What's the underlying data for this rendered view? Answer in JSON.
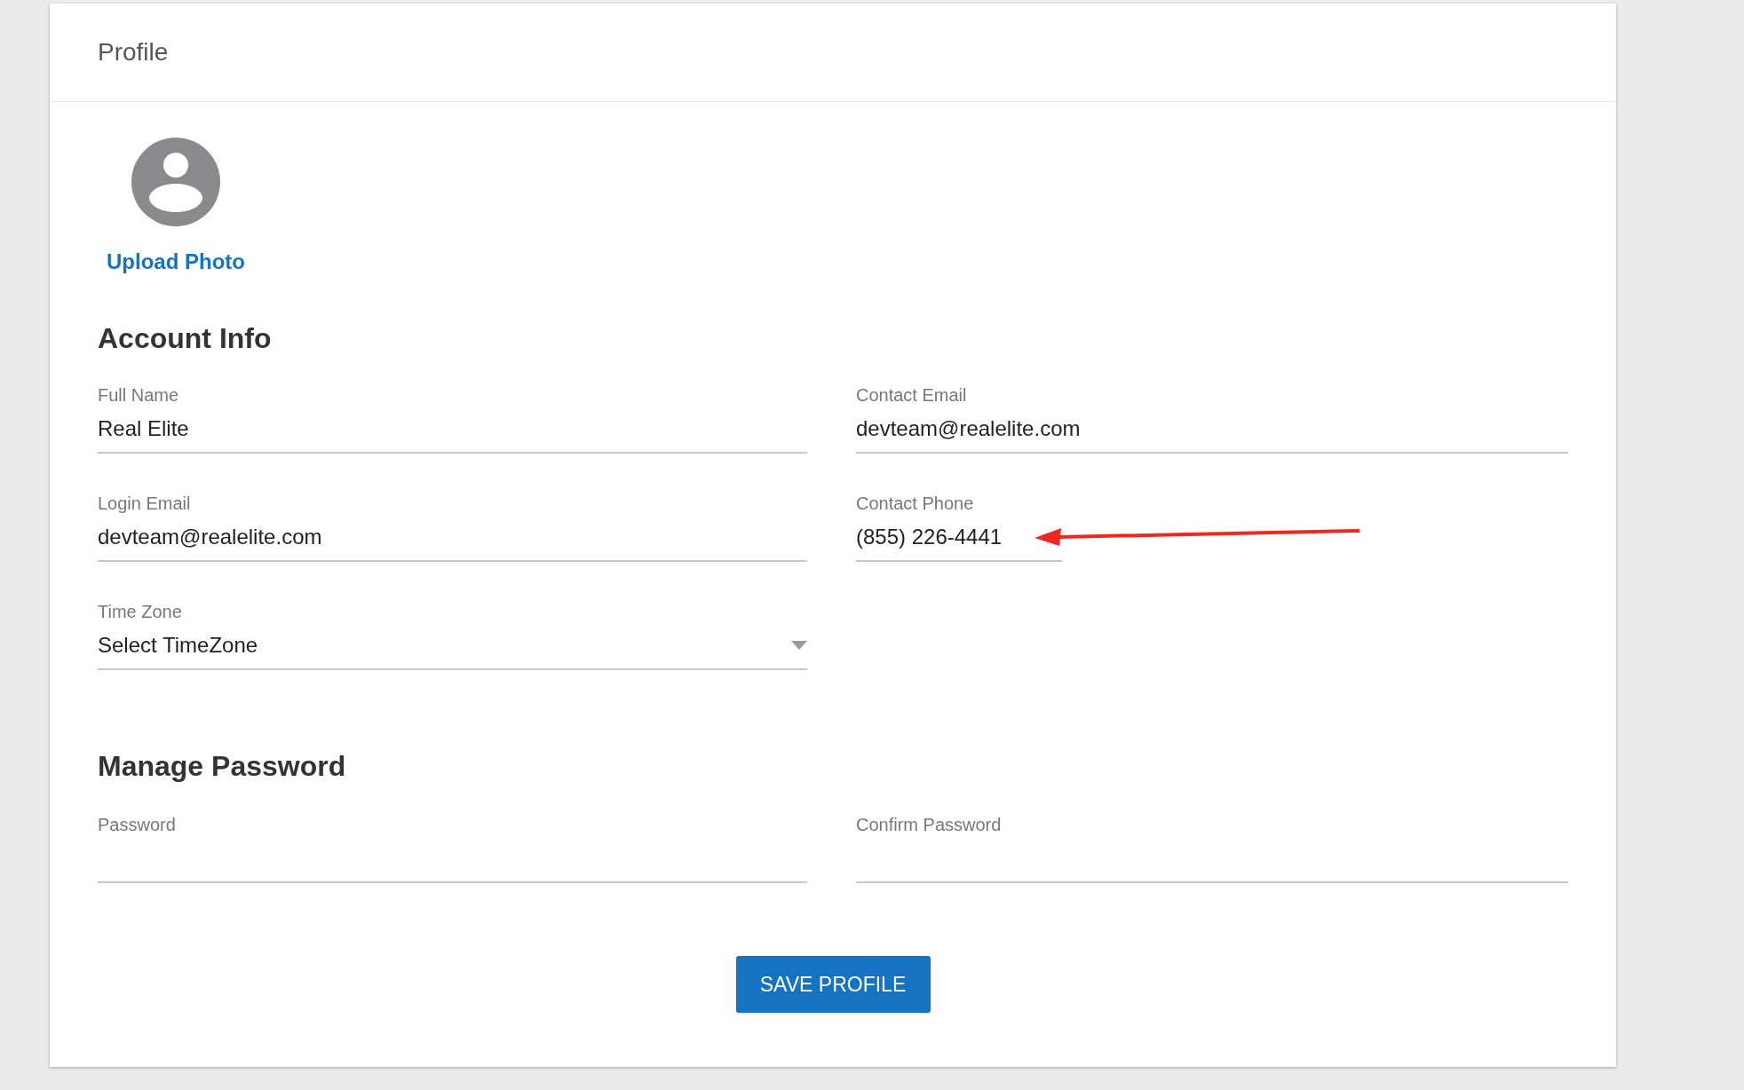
{
  "card": {
    "title": "Profile"
  },
  "photo": {
    "upload_label": "Upload Photo"
  },
  "sections": [
    {
      "title": "Account Info",
      "fields": [
        {
          "kind": "text",
          "label": "Full Name",
          "value": "Real Elite"
        },
        {
          "kind": "text",
          "label": "Contact Email",
          "value": "devteam@realelite.com"
        },
        {
          "kind": "text",
          "label": "Login Email",
          "value": "devteam@realelite.com"
        },
        {
          "kind": "phone",
          "label": "Contact Phone",
          "value": "(855) 226-4441",
          "annotated": true
        },
        {
          "kind": "select",
          "label": "Time Zone",
          "value": "Select TimeZone"
        }
      ]
    },
    {
      "title": "Manage Password",
      "fields": [
        {
          "kind": "password",
          "label": "Password"
        },
        {
          "kind": "password",
          "label": "Confirm Password"
        }
      ]
    }
  ],
  "save_button": "SAVE PROFILE"
}
